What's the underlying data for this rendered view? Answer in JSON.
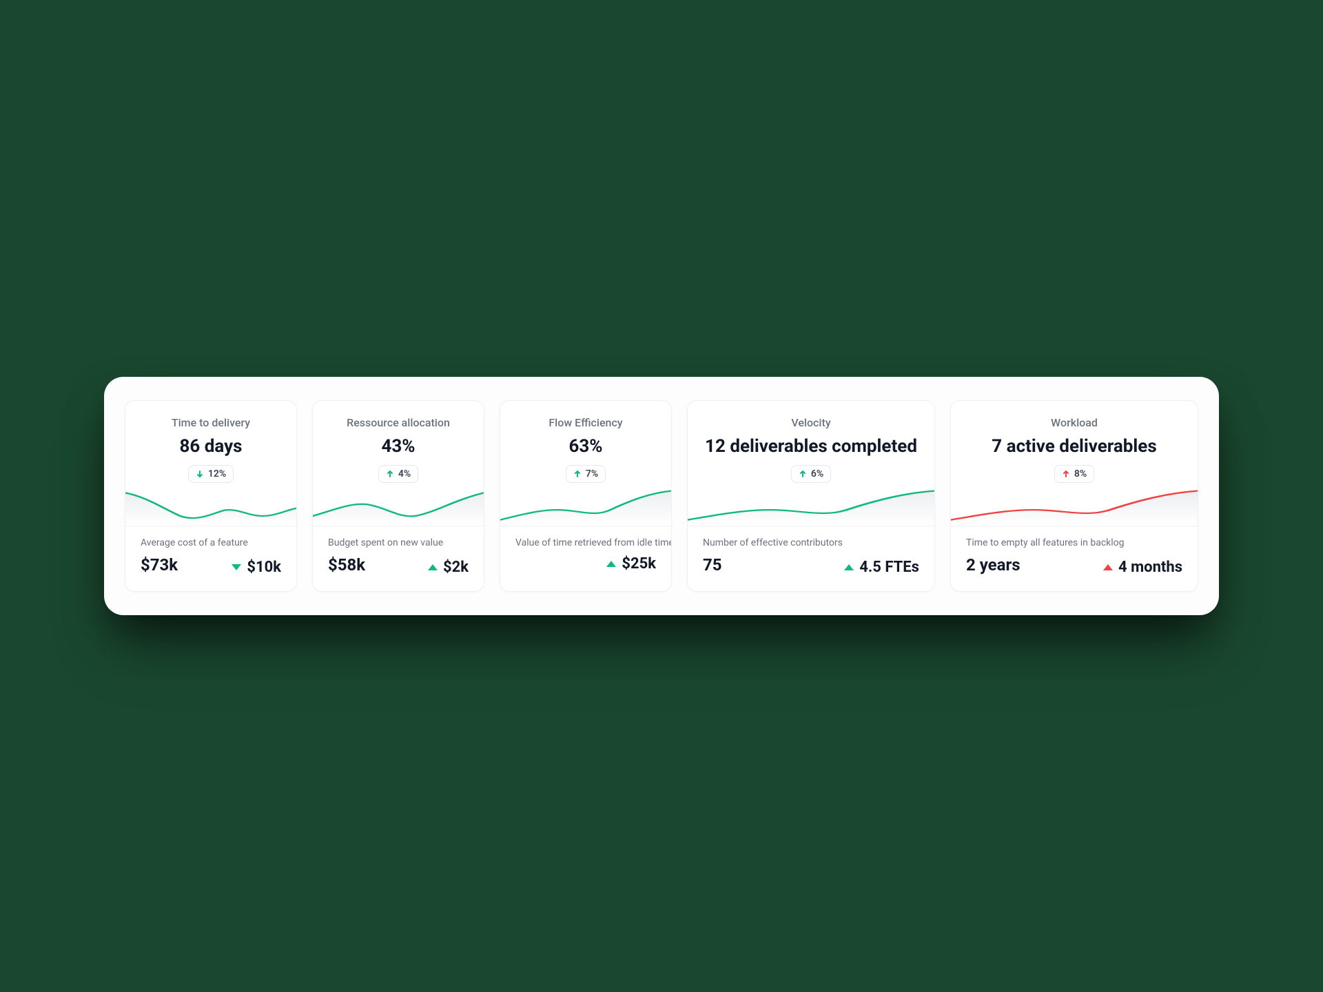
{
  "colors": {
    "green": "#10b981",
    "red": "#ef4444"
  },
  "cards": [
    {
      "id": "time-to-delivery",
      "width": "narrow",
      "title": "Time to delivery",
      "value": "86 days",
      "badge": {
        "dir": "down",
        "color": "green",
        "text": "12%"
      },
      "spark_color": "green",
      "spark_shape": "dip",
      "sub": "Average cost of a feature",
      "primary": "$73k",
      "delta": {
        "dir": "down",
        "color": "green",
        "text": "$10k"
      }
    },
    {
      "id": "resource-allocation",
      "width": "narrow",
      "title": "Ressource allocation",
      "value": "43%",
      "badge": {
        "dir": "up",
        "color": "green",
        "text": "4%"
      },
      "spark_color": "green",
      "spark_shape": "wave",
      "sub": "Budget spent on new value",
      "primary": "$58k",
      "delta": {
        "dir": "up",
        "color": "green",
        "text": "$2k"
      }
    },
    {
      "id": "flow-efficiency",
      "width": "narrow",
      "title": "Flow Efficiency",
      "value": "63%",
      "badge": {
        "dir": "up",
        "color": "green",
        "text": "7%"
      },
      "spark_color": "green",
      "spark_shape": "rise",
      "sub": "Value of time retrieved from idle time",
      "primary": "",
      "delta": {
        "dir": "up",
        "color": "green",
        "text": "$25k"
      }
    },
    {
      "id": "velocity",
      "width": "wide",
      "title": "Velocity",
      "value": "12 deliverables completed",
      "badge": {
        "dir": "up",
        "color": "green",
        "text": "6%"
      },
      "spark_color": "green",
      "spark_shape": "rise",
      "sub": "Number of effective contributors",
      "primary": "75",
      "delta": {
        "dir": "up",
        "color": "green",
        "text": "4.5 FTEs"
      }
    },
    {
      "id": "workload",
      "width": "wide",
      "title": "Workload",
      "value": "7 active deliverables",
      "badge": {
        "dir": "up",
        "color": "red",
        "text": "8%"
      },
      "spark_color": "red",
      "spark_shape": "rise",
      "sub": "Time to empty all features in backlog",
      "primary": "2 years",
      "delta": {
        "dir": "up",
        "color": "red",
        "text": "4 months"
      }
    }
  ],
  "chart_data": [
    {
      "card": "time-to-delivery",
      "type": "line",
      "x": [
        0,
        1,
        2,
        3,
        4,
        5,
        6,
        7,
        8,
        9
      ],
      "values": [
        56,
        50,
        36,
        24,
        28,
        40,
        40,
        30,
        32,
        38
      ],
      "ylim": [
        0,
        60
      ],
      "color": "#10b981"
    },
    {
      "card": "resource-allocation",
      "type": "line",
      "x": [
        0,
        1,
        2,
        3,
        4,
        5,
        6,
        7,
        8,
        9
      ],
      "values": [
        28,
        34,
        40,
        38,
        30,
        26,
        30,
        40,
        50,
        54
      ],
      "ylim": [
        0,
        60
      ],
      "color": "#10b981"
    },
    {
      "card": "flow-efficiency",
      "type": "line",
      "x": [
        0,
        1,
        2,
        3,
        4,
        5,
        6,
        7,
        8,
        9
      ],
      "values": [
        20,
        26,
        32,
        34,
        32,
        30,
        34,
        44,
        54,
        56
      ],
      "ylim": [
        0,
        60
      ],
      "color": "#10b981"
    },
    {
      "card": "velocity",
      "type": "line",
      "x": [
        0,
        1,
        2,
        3,
        4,
        5,
        6,
        7,
        8,
        9
      ],
      "values": [
        22,
        28,
        34,
        34,
        30,
        28,
        34,
        46,
        54,
        56
      ],
      "ylim": [
        0,
        60
      ],
      "color": "#10b981"
    },
    {
      "card": "workload",
      "type": "line",
      "x": [
        0,
        1,
        2,
        3,
        4,
        5,
        6,
        7,
        8,
        9
      ],
      "values": [
        30,
        24,
        22,
        26,
        32,
        32,
        28,
        34,
        48,
        56
      ],
      "ylim": [
        0,
        60
      ],
      "color": "#ef4444"
    }
  ]
}
